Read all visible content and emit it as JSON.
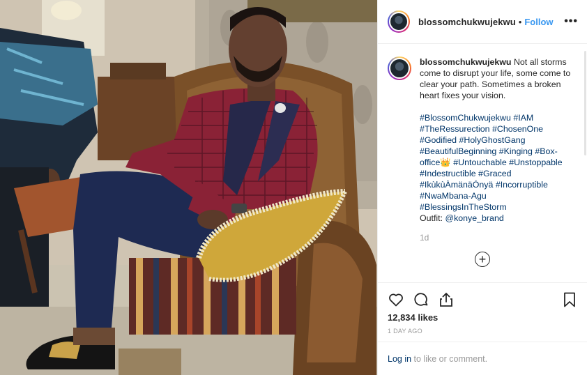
{
  "post": {
    "username": "blossomchukwujekwu",
    "dot": "•",
    "follow_label": "Follow",
    "more_label": "•••",
    "caption": "Not all storms come to disrupt your life, some come to clear your path. Sometimes a broken heart fixes your vision.",
    "hashtags": [
      "#BlossomChukwujekwu",
      "#IAM",
      "#TheRessurection",
      "#ChosenOne",
      "#Godified",
      "#HolyGhostGang",
      "#BeautifulBeginning",
      "#Kinging",
      "#Box-office👑",
      "#Untouchable",
      "#Unstoppable",
      "#Indestructible",
      "#Graced",
      "#IkùkùÀmänäÓnyä",
      "#Incorruptible",
      "#NwaMbana-Agu",
      "#BlessingsInTheStorm"
    ],
    "outfit_prefix": "Outfit: ",
    "outfit_mention": "@konye_brand",
    "caption_age": "1d",
    "load_more": "+",
    "likes": "12,834 likes",
    "date": "1 DAY AGO",
    "login_link": "Log in",
    "login_suffix": " to like or comment."
  },
  "icons": {
    "like": "heart-icon",
    "comment": "comment-icon",
    "share": "share-icon",
    "save": "bookmark-icon",
    "more": "more-options-icon"
  },
  "colors": {
    "link": "#3897f0",
    "hashtag": "#003569",
    "muted": "#999999",
    "border": "#efefef"
  }
}
